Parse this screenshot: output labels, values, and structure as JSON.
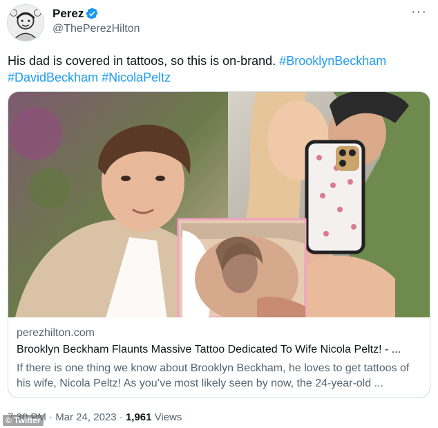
{
  "author": {
    "display_name": "Perez",
    "handle": "@ThePerezHilton",
    "avatar_icon": "avatar-sketch",
    "verified_icon": "verified-badge-icon",
    "verified_color": "#1d9bf0"
  },
  "menu": {
    "more_label": "···"
  },
  "tweet": {
    "text": "His dad is covered in tattoos,  so this is on-brand. ",
    "hashtags": [
      "#BrooklynBeckham",
      "#DavidBeckham",
      "#NicolaPeltz"
    ],
    "hashtag_color": "#1d9bf0"
  },
  "card": {
    "domain": "perezhilton.com",
    "title": "Brooklyn Beckham Flaunts Massive Tattoo Dedicated To Wife Nicola Peltz! - ...",
    "description": "If there is one thing we know about Brooklyn Beckham, he loves to get tattoos of his wife, Nicola Peltz! As you’ve most likely seen by now, the 24-year-old ..."
  },
  "footer": {
    "time": "7:30 PM",
    "separator": "·",
    "date": "Mar 24, 2023",
    "views_count": "1,961",
    "views_label": "Views"
  },
  "watermark": "© Twitter"
}
